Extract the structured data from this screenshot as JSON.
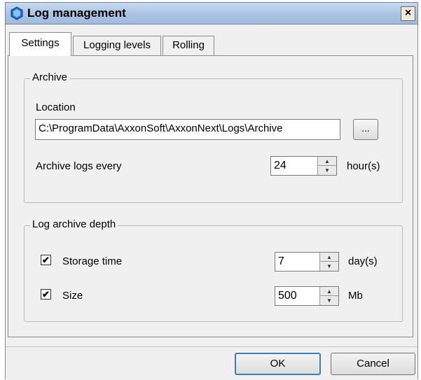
{
  "window": {
    "title": "Log management",
    "close_label": "×"
  },
  "tabs": [
    {
      "label": "Settings",
      "active": true
    },
    {
      "label": "Logging levels",
      "active": false
    },
    {
      "label": "Rolling",
      "active": false
    }
  ],
  "archive": {
    "legend": "Archive",
    "location_label": "Location",
    "location_value": "C:\\ProgramData\\AxxonSoft\\AxxonNext\\Logs\\Archive",
    "browse_label": "...",
    "interval_label": "Archive logs every",
    "interval_value": "24",
    "interval_unit": "hour(s)"
  },
  "depth": {
    "legend": "Log archive depth",
    "storage_time": {
      "label": "Storage time",
      "checked": true,
      "value": "7",
      "unit": "day(s)"
    },
    "size": {
      "label": "Size",
      "checked": true,
      "value": "500",
      "unit": "Mb"
    }
  },
  "buttons": {
    "ok": "OK",
    "cancel": "Cancel"
  },
  "icons": {
    "app": "hexagon-app-icon",
    "checkmark": "✔"
  },
  "colors": {
    "titlebar": "#a9c3e2",
    "app_icon": "#2f7fd0",
    "default_button_border": "#3c7fb1"
  }
}
